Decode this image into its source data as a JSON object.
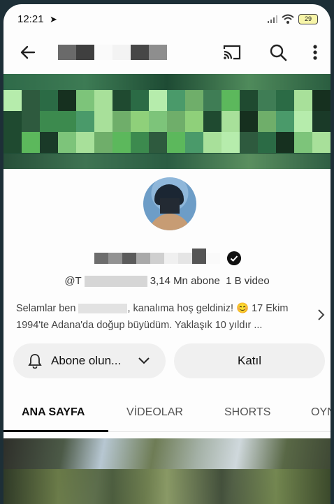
{
  "status_bar": {
    "time": "12:21",
    "battery": "29"
  },
  "channel": {
    "handle_prefix": "@T",
    "subscribers": "3,14 Mn abone",
    "videos": "1 B video",
    "description_part1": "Selamlar ben",
    "description_part2": ", kanalıma hoş geldiniz! 😊 17 Ekim 1994'te Adana'da doğup büyüdüm. Yaklaşık 10 yıldır ..."
  },
  "buttons": {
    "subscribe_label": "Abone olun...",
    "join_label": "Katıl"
  },
  "tabs": [
    {
      "label": "ANA SAYFA"
    },
    {
      "label": "VİDEOLAR"
    },
    {
      "label": "SHORTS"
    },
    {
      "label": "OYN"
    }
  ],
  "icons": [
    "back-arrow-icon",
    "cast-icon",
    "search-icon",
    "more-vert-icon",
    "verified-icon",
    "bell-icon",
    "chevron-down-icon",
    "chevron-right-icon"
  ]
}
